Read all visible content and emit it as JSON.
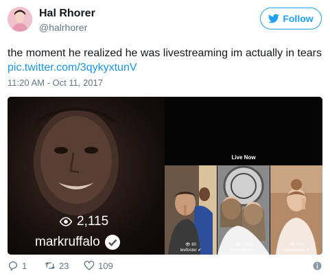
{
  "author": {
    "name": "Hal Rhorer",
    "handle": "@halrhorer"
  },
  "follow_button": {
    "label": "Follow"
  },
  "tweet": {
    "text": "the moment he realized he was livestreaming im actually in tears",
    "link": "pic.twitter.com/3qykyxtunV",
    "timestamp": "11:20 AM - Oct 11, 2017"
  },
  "media": {
    "main_stream": {
      "viewers": "2,115",
      "username": "markruffalo"
    },
    "live_now_label": "Live Now",
    "thumbnails": [
      {
        "count": "80",
        "name": "levifoster"
      },
      {
        "count": "1,953",
        "name": "jacyandkacy"
      },
      {
        "count": "470",
        "name": "delilahbelle"
      }
    ]
  },
  "actions": {
    "replies": "1",
    "retweets": "23",
    "likes": "109"
  },
  "colors": {
    "accent": "#1da1f2",
    "link": "#1b95e0",
    "muted": "#657786"
  }
}
